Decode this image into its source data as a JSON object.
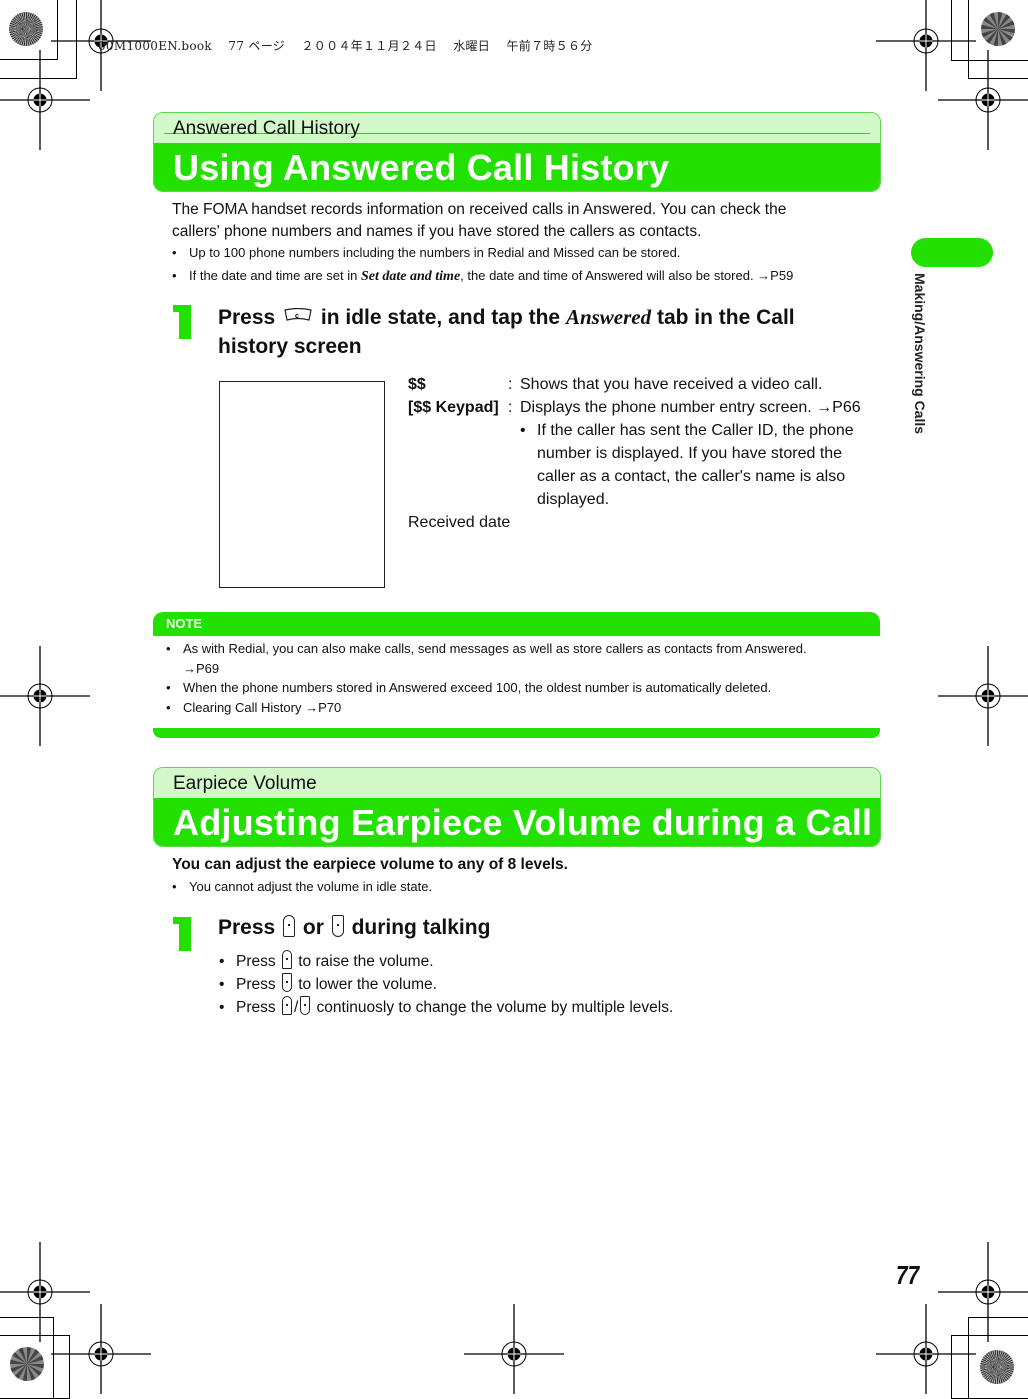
{
  "print_slug": "00M1000EN.book　 77 ページ 　２００４年１１月２４日　 水曜日　 午前７時５６分",
  "side_tab": {
    "label": "Making/Answering Calls",
    "color": "#22e000"
  },
  "page_number": "77",
  "colors": {
    "accent": "#22e000",
    "accent_light": "#d3f8c9"
  },
  "section1": {
    "subtitle": "Answered Call History",
    "title": "Using Answered Call History",
    "intro_line1": "The FOMA handset records information on received calls in Answered. You can check the",
    "intro_line2": "callers' phone numbers and names if you have stored the callers as contacts.",
    "bullets": [
      {
        "text": "Up to 100 phone numbers including the numbers in Redial and Missed can be stored."
      },
      {
        "pre": "If the date and time are set in ",
        "italic": "Set date and time",
        "post": ", the date and time of Answered will also be stored. →P59"
      }
    ],
    "step": {
      "number": "1",
      "pre": "Press ",
      "icon": "call-history-key-icon",
      "mid": " in idle state, and tap the ",
      "italic": "Answered",
      "post": " tab in the Call",
      "line2": "history screen"
    },
    "descriptions": [
      {
        "term": "$$",
        "colon": ":",
        "value": "Shows that you have received a video call."
      },
      {
        "term": "[$$ Keypad]",
        "colon": ":",
        "value": "Displays the phone number entry screen. →P66"
      }
    ],
    "desc_subbullet": [
      "If the caller has sent the Caller ID, the phone",
      "number is displayed. If you have stored the",
      "caller as a contact, the caller's name is also",
      "displayed."
    ],
    "received_date_label": "Received date"
  },
  "note": {
    "heading": "NOTE",
    "items": [
      {
        "line1": "As with Redial, you can also make calls, send messages as well as store callers as contacts from Answered.",
        "line2": "→P69"
      },
      {
        "line1": "When the phone numbers stored in Answered exceed 100, the oldest number is automatically deleted."
      },
      {
        "line1": "Clearing Call History →P70"
      }
    ]
  },
  "section2": {
    "subtitle": "Earpiece Volume",
    "title": "Adjusting Earpiece Volume during a Call",
    "lead": "You can adjust the earpiece volume to any of 8 levels.",
    "lead_bullet": "You cannot adjust the volume in idle state.",
    "step": {
      "number": "1",
      "pre": "Press ",
      "mid": " or ",
      "post": " during talking"
    },
    "bullets": [
      {
        "pre": "Press ",
        "post": " to raise the volume.",
        "key": "volume-up-key-icon"
      },
      {
        "pre": "Press ",
        "post": " to lower the volume.",
        "key": "volume-down-key-icon"
      },
      {
        "pre": "Press ",
        "sep": "/",
        "post": " continuosly to change the volume by multiple levels.",
        "key": "volume-up-down-key-icon"
      }
    ]
  }
}
